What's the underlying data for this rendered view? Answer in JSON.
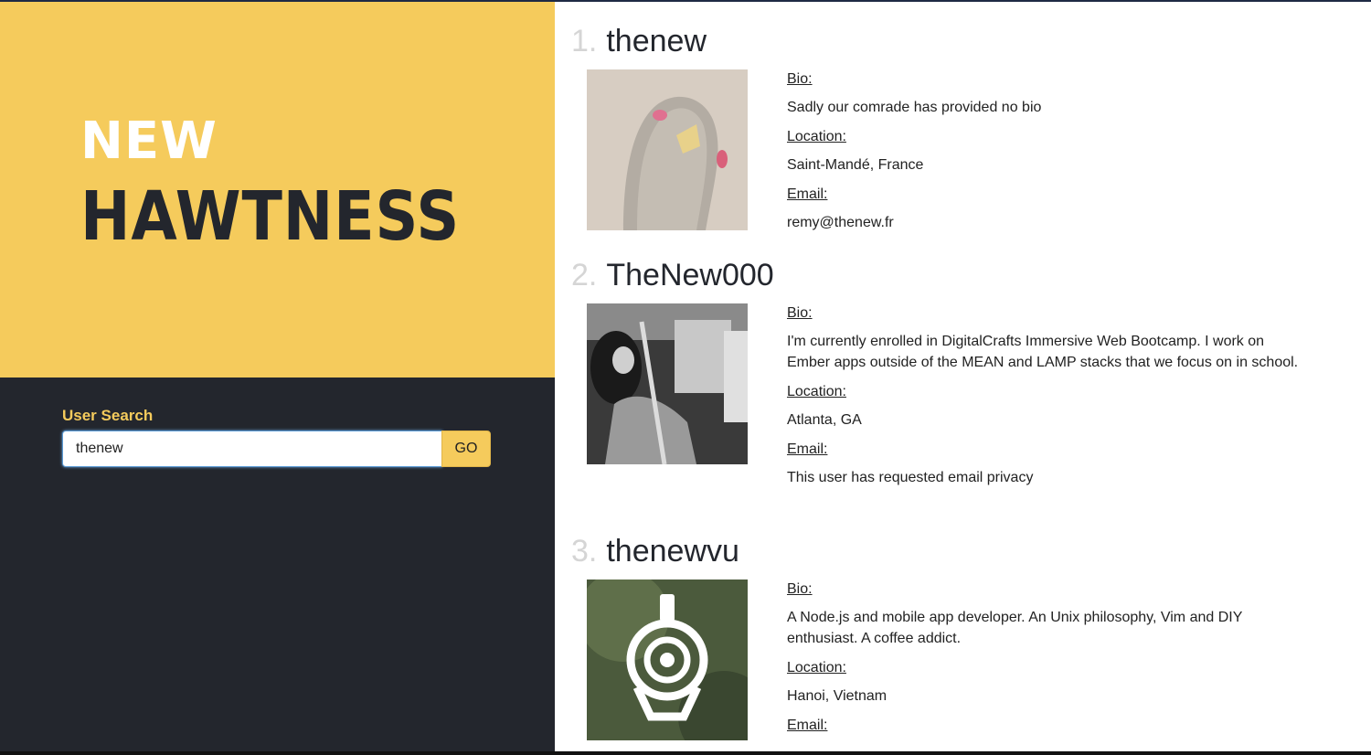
{
  "brand": {
    "line1": "NEW",
    "line2": "HAWTNESS"
  },
  "search": {
    "label": "User Search",
    "value": "thenew",
    "button": "GO"
  },
  "users": [
    {
      "num": "1.",
      "name": "thenew",
      "bio_label": "Bio:",
      "bio": "Sadly our comrade has provided no bio",
      "location_label": "Location:",
      "location": "Saint-Mandé, France",
      "email_label": "Email:",
      "email": "remy@thenew.fr"
    },
    {
      "num": "2.",
      "name": "TheNew000",
      "bio_label": "Bio:",
      "bio": "I'm currently enrolled in DigitalCrafts Immersive Web Bootcamp. I work on Ember apps outside of the MEAN and LAMP stacks that we focus on in school.",
      "location_label": "Location:",
      "location": "Atlanta, GA",
      "email_label": "Email:",
      "email": "This user has requested email privacy"
    },
    {
      "num": "3.",
      "name": "thenewvu",
      "bio_label": "Bio:",
      "bio": "A Node.js and mobile app developer. An Unix philosophy, Vim and DIY enthusiast. A coffee addict.",
      "location_label": "Location:",
      "location": "Hanoi, Vietnam",
      "email_label": "Email:",
      "email": ""
    }
  ],
  "colors": {
    "accent": "#f5cb5c",
    "dark": "#23262d"
  }
}
